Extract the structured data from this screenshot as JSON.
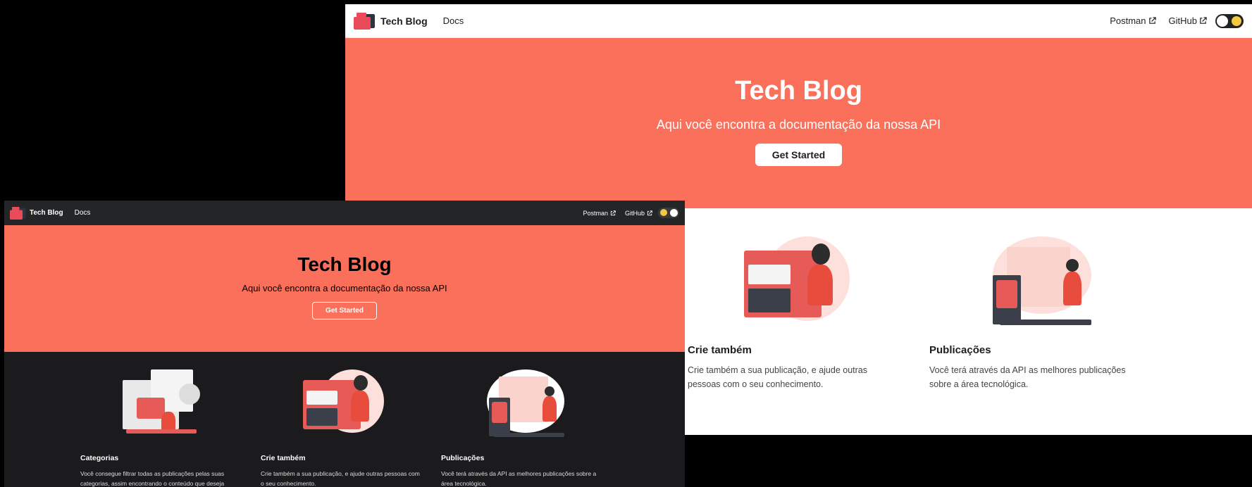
{
  "light": {
    "nav": {
      "brand": "Tech Blog",
      "docs": "Docs",
      "postman": "Postman",
      "github": "GitHub"
    },
    "hero": {
      "title": "Tech Blog",
      "subtitle": "Aqui você encontra a documentação da nossa API",
      "cta": "Get Started"
    },
    "features": [
      {
        "title": "Crie também",
        "text": "Crie também a sua publicação, e ajude outras pessoas com o seu conhecimento."
      },
      {
        "title": "Publicações",
        "text": "Você terá através da API as melhores publicações sobre a área tecnológica."
      }
    ]
  },
  "dark": {
    "nav": {
      "brand": "Tech Blog",
      "docs": "Docs",
      "postman": "Postman",
      "github": "GitHub"
    },
    "hero": {
      "title": "Tech Blog",
      "subtitle": "Aqui você encontra a documentação da nossa API",
      "cta": "Get Started"
    },
    "features": [
      {
        "title": "Categorias",
        "text": "Você consegue filtrar todas as publicações pelas suas categorias, assim encontrando o conteúdo que deseja"
      },
      {
        "title": "Crie também",
        "text": "Crie também a sua publicação, e ajude outras pessoas com o seu conhecimento."
      },
      {
        "title": "Publicações",
        "text": "Você terá através da API as melhores publicações sobre a área tecnológica."
      }
    ]
  },
  "colors": {
    "accent": "#fa705b",
    "dark_bg": "#1b1b1d",
    "dark_nav": "#242526"
  }
}
